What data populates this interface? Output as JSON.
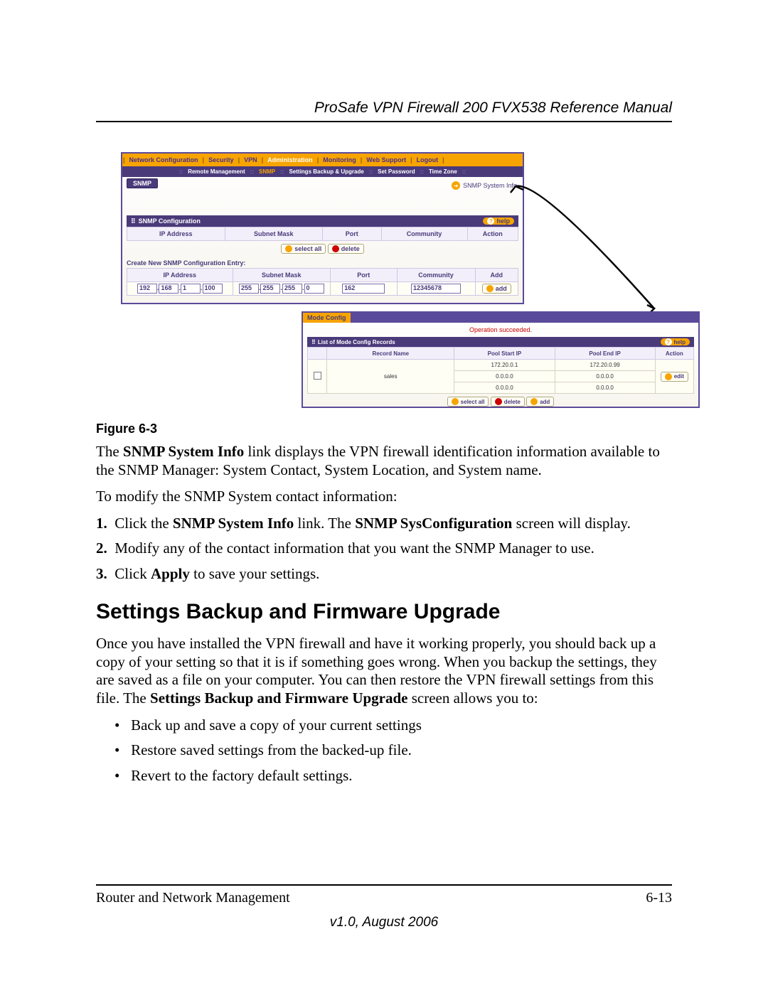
{
  "doc": {
    "running_head": "ProSafe VPN Firewall 200 FVX538 Reference Manual",
    "figure_caption": "Figure 6-3",
    "p1_pre": "The ",
    "p1_b1": "SNMP System Info",
    "p1_post": " link displays the VPN firewall identification information available to the SNMP Manager: System Contact, System Location, and System name.",
    "p2": "To modify the SNMP System contact information:",
    "s1_n": "1.",
    "s1a": "Click the ",
    "s1b": "SNMP System Info",
    "s1c": " link. The ",
    "s1d": "SNMP SysConfiguration",
    "s1e": " screen will display.",
    "s2_n": "2.",
    "s2": "Modify any of the contact information that you want the SNMP Manager to use.",
    "s3_n": "3.",
    "s3a": "Click ",
    "s3b": "Apply",
    "s3c": " to save your settings.",
    "h2": "Settings Backup and Firmware Upgrade",
    "p3a": "Once you have installed the VPN firewall and have it working properly, you should back up a copy of your setting so that it is if something goes wrong. When you backup the settings, they are saved as a file on your computer. You can then restore the VPN firewall settings from this file. The ",
    "p3b": "Settings Backup and Firmware Upgrade",
    "p3c": " screen allows you to:",
    "b1": "Back up and save a copy of your current settings",
    "b2": "Restore saved settings from the backed-up file.",
    "b3": "Revert to the factory default settings.",
    "footer_left": "Router and Network Management",
    "footer_right": "6-13",
    "version": "v1.0, August 2006"
  },
  "ui": {
    "tabs1": {
      "netconf": "Network Configuration",
      "security": "Security",
      "vpn": "VPN",
      "admin": "Administration",
      "monitoring": "Monitoring",
      "websupport": "Web Support",
      "logout": "Logout"
    },
    "tabs2": {
      "remote": "Remote Management",
      "snmp": "SNMP",
      "backup": "Settings Backup & Upgrade",
      "setpw": "Set Password",
      "tz": "Time Zone"
    },
    "snmp_pill": "SNMP",
    "sys_info": "SNMP System Info",
    "section1": "SNMP Configuration",
    "help": "help",
    "hdr": {
      "ip": "IP Address",
      "mask": "Subnet Mask",
      "port": "Port",
      "community": "Community",
      "action": "Action",
      "add": "Add"
    },
    "btn": {
      "select_all": "select all",
      "delete": "delete",
      "add": "add",
      "edit": "edit"
    },
    "subhead": "Create New SNMP Configuration Entry:",
    "ip": {
      "a": "192",
      "b": "168",
      "c": "1",
      "d": "100"
    },
    "mask": {
      "a": "255",
      "b": "255",
      "c": "255",
      "d": "0"
    },
    "port": "162",
    "community": "12345678",
    "mc": {
      "tab": "Mode Config",
      "msg": "Operation succeeded.",
      "bar": "List of Mode Config Records",
      "hdr": {
        "blank": "",
        "name": "Record Name",
        "start": "Pool Start IP",
        "end": "Pool End IP",
        "action": "Action"
      },
      "row": {
        "name": "sales",
        "s1": "172.20.0.1",
        "e1": "172.20.0.99",
        "s2": "0.0.0.0",
        "e2": "0.0.0.0",
        "s3": "0.0.0.0",
        "e3": "0.0.0.0"
      }
    }
  }
}
